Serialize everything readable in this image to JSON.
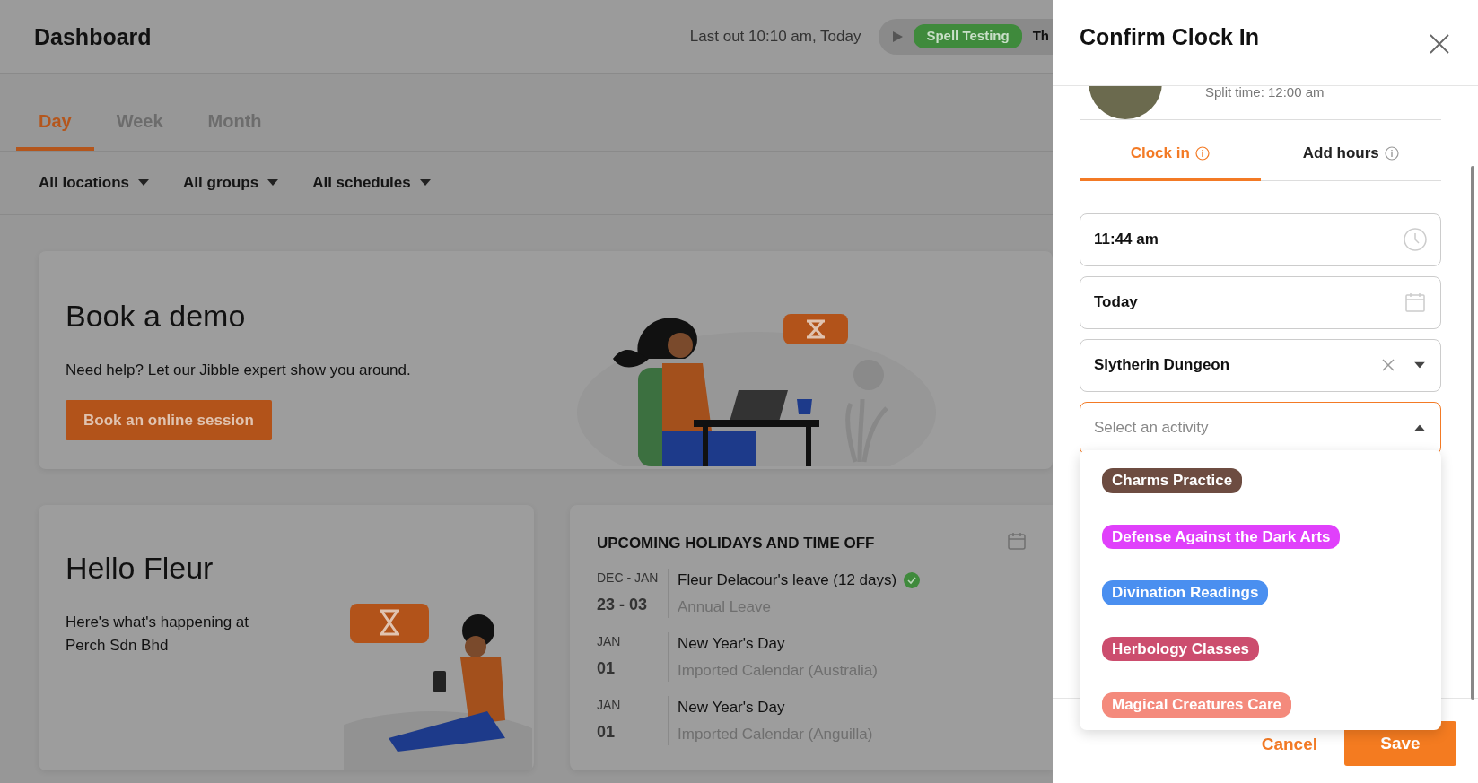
{
  "header": {
    "title": "Dashboard",
    "last_out": "Last out 10:10 am, Today",
    "timer": {
      "activity": "Spell Testing",
      "color": "#3f8a3c",
      "next_text": "Th"
    }
  },
  "period_tabs": [
    {
      "label": "Day",
      "selected": true
    },
    {
      "label": "Week",
      "selected": false
    },
    {
      "label": "Month",
      "selected": false
    }
  ],
  "filters": [
    "All locations",
    "All groups",
    "All schedules"
  ],
  "demo_card": {
    "title": "Book a demo",
    "text": "Need help? Let our Jibble expert show you around.",
    "button": "Book an online session"
  },
  "hello_card": {
    "title": "Hello Fleur",
    "text": "Here's what's happening at Perch Sdn Bhd"
  },
  "holidays": {
    "title": "UPCOMING HOLIDAYS AND TIME OFF",
    "items": [
      {
        "month": "DEC - JAN",
        "day": "23 - 03",
        "name": "Fleur Delacour's leave (12 days)",
        "approved": true,
        "subtitle": "Annual Leave"
      },
      {
        "month": "JAN",
        "day": "01",
        "name": "New Year's Day",
        "approved": false,
        "subtitle": "Imported Calendar (Australia)"
      },
      {
        "month": "JAN",
        "day": "01",
        "name": "New Year's Day",
        "approved": false,
        "subtitle": "Imported Calendar (Anguilla)"
      }
    ]
  },
  "panel": {
    "title": "Confirm Clock In",
    "split_time": "Split time: 12:00 am",
    "tabs": [
      {
        "label": "Clock in",
        "selected": true
      },
      {
        "label": "Add hours",
        "selected": false
      }
    ],
    "time": "11:44 am",
    "date": "Today",
    "location": "Slytherin Dungeon",
    "activity": {
      "placeholder": "Select an activity",
      "expanded": true,
      "options": [
        {
          "label": "Charms Practice",
          "color": "#6d4c41"
        },
        {
          "label": "Defense Against the Dark Arts",
          "color": "#e040fb"
        },
        {
          "label": "Divination Readings",
          "color": "#4a8ff0"
        },
        {
          "label": "Herbology Classes",
          "color": "#cc4d6e"
        },
        {
          "label": "Magical Creatures Care",
          "color": "#f48a7c"
        }
      ]
    },
    "cancel": "Cancel",
    "save": "Save"
  }
}
